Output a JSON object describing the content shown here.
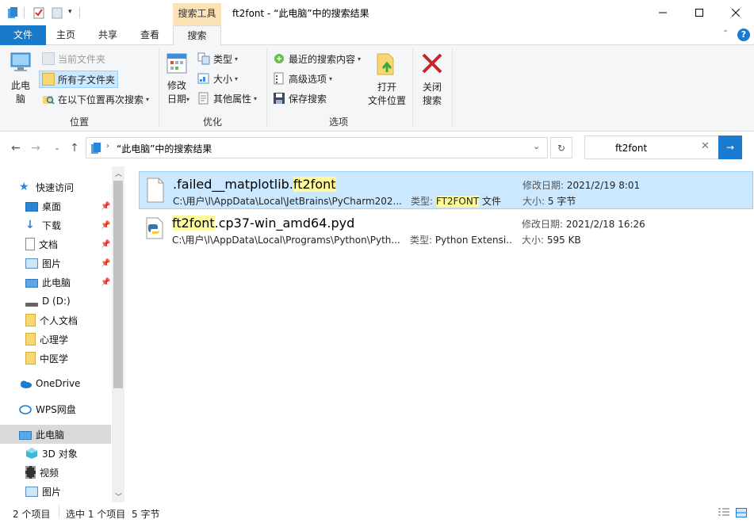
{
  "window": {
    "title": "ft2font - “此电脑”中的搜索结果",
    "context_tab": "搜索工具"
  },
  "tabs": [
    {
      "label": "文件"
    },
    {
      "label": "主页"
    },
    {
      "label": "共享"
    },
    {
      "label": "查看"
    },
    {
      "label": "搜索"
    }
  ],
  "ribbon": {
    "location": {
      "label": "位置",
      "this_pc": "此电\n脑",
      "current_folder": "当前文件夹",
      "all_subfolders": "所有子文件夹",
      "search_again": "在以下位置再次搜索"
    },
    "refine": {
      "label": "优化",
      "date_modified": "修改\n日期",
      "kind": "类型",
      "size": "大小",
      "other_props": "其他属性"
    },
    "options": {
      "label": "选项",
      "recent_searches": "最近的搜索内容",
      "advanced": "高级选项",
      "save_search": "保存搜索",
      "open_location": "打开\n文件位置",
      "close_search": "关闭\n搜索"
    }
  },
  "address": {
    "path": "“此电脑”中的搜索结果"
  },
  "search": {
    "value": "ft2font"
  },
  "nav": {
    "quick_access": "快速访问",
    "items": [
      {
        "label": "桌面",
        "pinned": true
      },
      {
        "label": "下载",
        "pinned": true
      },
      {
        "label": "文档",
        "pinned": true
      },
      {
        "label": "图片",
        "pinned": true
      },
      {
        "label": "此电脑",
        "pinned": true
      },
      {
        "label": "D (D:)",
        "pinned": false
      },
      {
        "label": "个人文档",
        "pinned": false
      },
      {
        "label": "心理学",
        "pinned": false
      },
      {
        "label": "中医学",
        "pinned": false
      }
    ],
    "onedrive": "OneDrive",
    "wps": "WPS网盘",
    "this_pc": "此电脑",
    "pc_items": [
      {
        "label": "3D 对象"
      },
      {
        "label": "视频"
      },
      {
        "label": "图片"
      }
    ]
  },
  "files": [
    {
      "name_pre": ".failed__matplotlib.",
      "name_hl": "ft2font",
      "name_post": "",
      "path": "C:\\用户\\l\\AppData\\Local\\JetBrains\\PyCharm202...",
      "type_label": "类型:",
      "type_hl": "FT2FONT",
      "type_post": " 文件",
      "date_label": "修改日期:",
      "date": "2021/2/19 8:01",
      "size_label": "大小:",
      "size": "5 字节"
    },
    {
      "name_pre": "",
      "name_hl": "ft2font",
      "name_post": ".cp37-win_amd64.pyd",
      "path": "C:\\用户\\l\\AppData\\Local\\Programs\\Python\\Pyth...",
      "type_label": "类型:",
      "type_hl": "",
      "type_post": "Python Extensi...",
      "date_label": "修改日期:",
      "date": "2021/2/18 16:26",
      "size_label": "大小:",
      "size": "595 KB"
    }
  ],
  "status": {
    "count": "2 个项目",
    "selected": "选中 1 个项目",
    "size": "5 字节"
  },
  "colors": {
    "accent": "#1979ca",
    "selection": "#cce8ff",
    "highlight": "#fffa9b",
    "context_tab": "#fbe2b7"
  }
}
